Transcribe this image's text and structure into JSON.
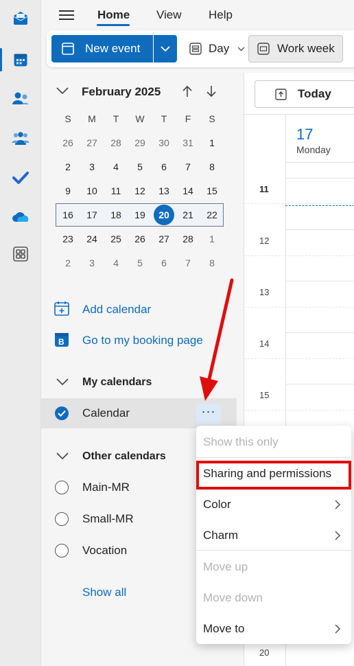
{
  "topbar": {
    "tabs": [
      "Home",
      "View",
      "Help"
    ]
  },
  "ribbon": {
    "new_event_label": "New event",
    "day_label": "Day",
    "work_week_label": "Work week"
  },
  "mini_calendar": {
    "title": "February 2025",
    "weekday_headers": [
      "S",
      "M",
      "T",
      "W",
      "T",
      "F",
      "S"
    ],
    "weeks": [
      [
        "26",
        "27",
        "28",
        "29",
        "30",
        "31",
        "1"
      ],
      [
        "2",
        "3",
        "4",
        "5",
        "6",
        "7",
        "8"
      ],
      [
        "9",
        "10",
        "11",
        "12",
        "13",
        "14",
        "15"
      ],
      [
        "16",
        "17",
        "18",
        "19",
        "20",
        "21",
        "22"
      ],
      [
        "23",
        "24",
        "25",
        "26",
        "27",
        "28",
        "1"
      ],
      [
        "2",
        "3",
        "4",
        "5",
        "6",
        "7",
        "8"
      ]
    ],
    "today": "20"
  },
  "nav": {
    "add_calendar": "Add calendar",
    "booking_page": "Go to my booking page"
  },
  "my_calendars": {
    "heading": "My calendars",
    "items": [
      {
        "label": "Calendar",
        "checked": true
      }
    ]
  },
  "other_calendars": {
    "heading": "Other calendars",
    "items": [
      {
        "label": "Main-MR"
      },
      {
        "label": "Small-MR"
      },
      {
        "label": "Vocation"
      }
    ],
    "show_all": "Show all"
  },
  "grid": {
    "today_label": "Today",
    "date_number": "17",
    "date_weekday": "Monday",
    "hours": [
      "11",
      "12",
      "13",
      "14",
      "15",
      "20"
    ]
  },
  "more_button": "···",
  "context_menu": {
    "items": [
      {
        "label": "Show this only",
        "disabled": true
      },
      {
        "label": "Sharing and permissions",
        "disabled": false
      },
      {
        "label": "Color",
        "disabled": false,
        "submenu": true
      },
      {
        "label": "Charm",
        "disabled": false,
        "submenu": true
      },
      {
        "label": "Move up",
        "disabled": true
      },
      {
        "label": "Move down",
        "disabled": true
      },
      {
        "label": "Move to",
        "disabled": false,
        "submenu": true
      }
    ]
  },
  "colors": {
    "accent": "#0f6cbd",
    "annotation_red": "#e00d0d"
  }
}
